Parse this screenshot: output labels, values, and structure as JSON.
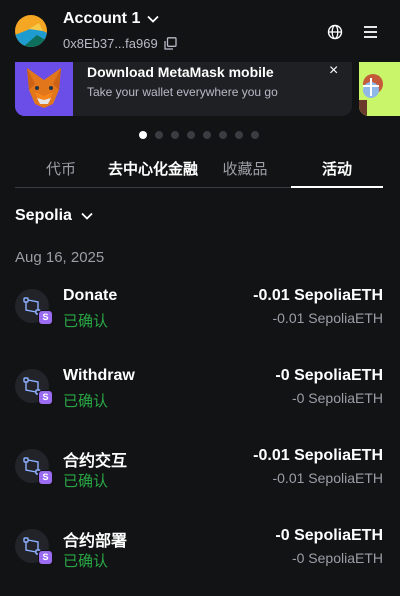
{
  "header": {
    "account_name": "Account 1",
    "account_address": "0x8Eb37...fa969"
  },
  "banner": {
    "title": "Download MetaMask mobile",
    "subtitle": "Take your wallet everywhere you go",
    "close_label": "×"
  },
  "carousel": {
    "total": 8,
    "active": 0
  },
  "tabs": [
    {
      "label": "代币"
    },
    {
      "label": "去中心化金融"
    },
    {
      "label": "收藏品"
    },
    {
      "label": "活动"
    }
  ],
  "network": {
    "label": "Sepolia"
  },
  "activity": {
    "date": "Aug 16, 2025",
    "items": [
      {
        "title": "Donate",
        "status": "已确认",
        "amount": "-0.01 SepoliaETH",
        "amount_secondary": "-0.01 SepoliaETH"
      },
      {
        "title": "Withdraw",
        "status": "已确认",
        "amount": "-0 SepoliaETH",
        "amount_secondary": "-0 SepoliaETH"
      },
      {
        "title": "合约交互",
        "status": "已确认",
        "amount": "-0.01 SepoliaETH",
        "amount_secondary": "-0.01 SepoliaETH"
      },
      {
        "title": "合约部署",
        "status": "已确认",
        "amount": "-0 SepoliaETH",
        "amount_secondary": "-0 SepoliaETH"
      }
    ],
    "badge_letter": "S"
  },
  "colors": {
    "background": "#121314",
    "confirmed": "#28a745",
    "badge": "#9b6bf2"
  }
}
